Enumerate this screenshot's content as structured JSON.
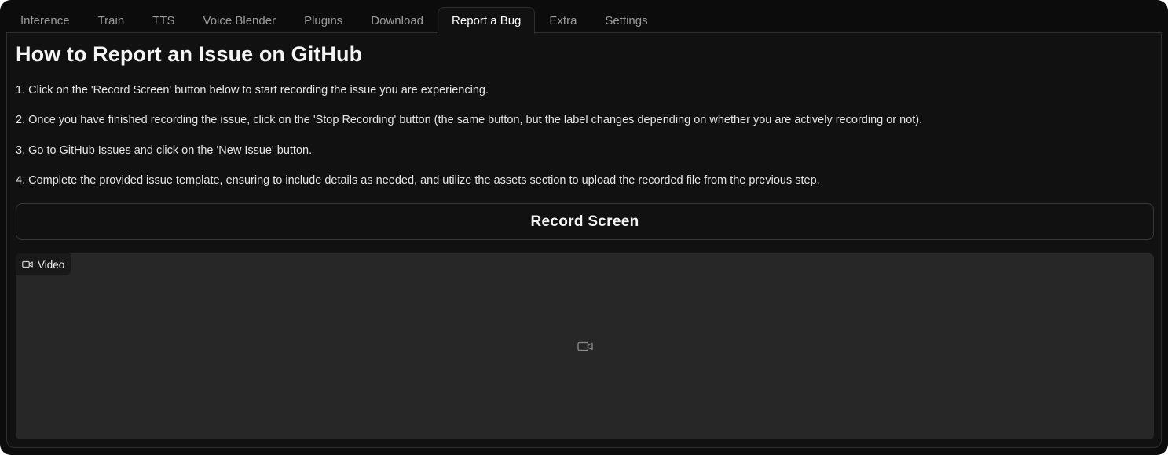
{
  "tabs": [
    {
      "label": "Inference",
      "active": false
    },
    {
      "label": "Train",
      "active": false
    },
    {
      "label": "TTS",
      "active": false
    },
    {
      "label": "Voice Blender",
      "active": false
    },
    {
      "label": "Plugins",
      "active": false
    },
    {
      "label": "Download",
      "active": false
    },
    {
      "label": "Report a Bug",
      "active": true
    },
    {
      "label": "Extra",
      "active": false
    },
    {
      "label": "Settings",
      "active": false
    }
  ],
  "report": {
    "title": "How to Report an Issue on GitHub",
    "step1": "1. Click on the 'Record Screen' button below to start recording the issue you are experiencing.",
    "step2": "2. Once you have finished recording the issue, click on the 'Stop Recording' button (the same button, but the label changes depending on whether you are actively recording or not).",
    "step3_prefix": "3. Go to ",
    "step3_link": "GitHub Issues",
    "step3_suffix": " and click on the 'New Issue' button.",
    "step4": "4. Complete the provided issue template, ensuring to include details as needed, and utilize the assets section to upload the recorded file from the previous step.",
    "record_button": "Record Screen"
  },
  "video": {
    "label": "Video",
    "label_icon": "video-camera-icon",
    "placeholder_icon": "video-camera-icon"
  },
  "colors": {
    "background": "#0d0c0c",
    "panel": "#121111",
    "video_area": "#272727",
    "text": "#e6e6e6",
    "tab_inactive": "#9b9b9b"
  }
}
